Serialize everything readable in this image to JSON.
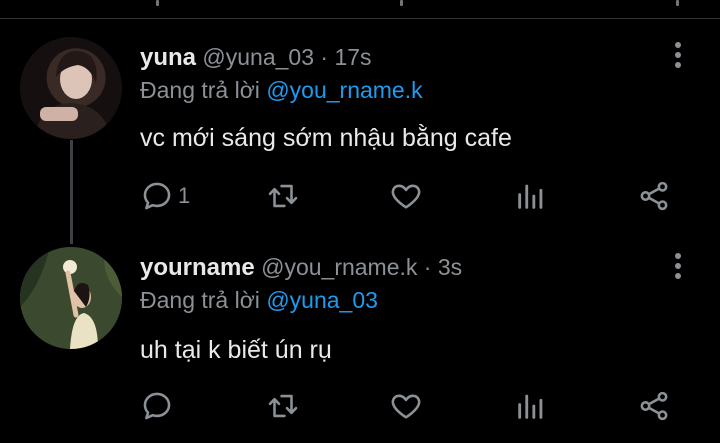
{
  "tweets": [
    {
      "display_name": "yuna",
      "handle": "@yuna_03",
      "separator": "·",
      "time": "17s",
      "reply_prefix": "Đang trả lời",
      "reply_to": "@you_rname.k",
      "text": "vc mới sáng sớm nhậu bằng cafe",
      "reply_count": "1"
    },
    {
      "display_name": "yourname",
      "handle": "@you_rname.k",
      "separator": "·",
      "time": "3s",
      "reply_prefix": "Đang trả lời",
      "reply_to": "@yuna_03",
      "text": "uh tại k biết ún rụ",
      "reply_count": ""
    }
  ],
  "icons": {
    "reply": "reply-icon",
    "retweet": "retweet-icon",
    "like": "heart-icon",
    "analytics": "analytics-icon",
    "share": "share-icon",
    "more": "more-options-icon"
  },
  "colors": {
    "background": "#000000",
    "text": "#e7e9ea",
    "muted": "#8b9197",
    "accent": "#1d9bf0"
  }
}
